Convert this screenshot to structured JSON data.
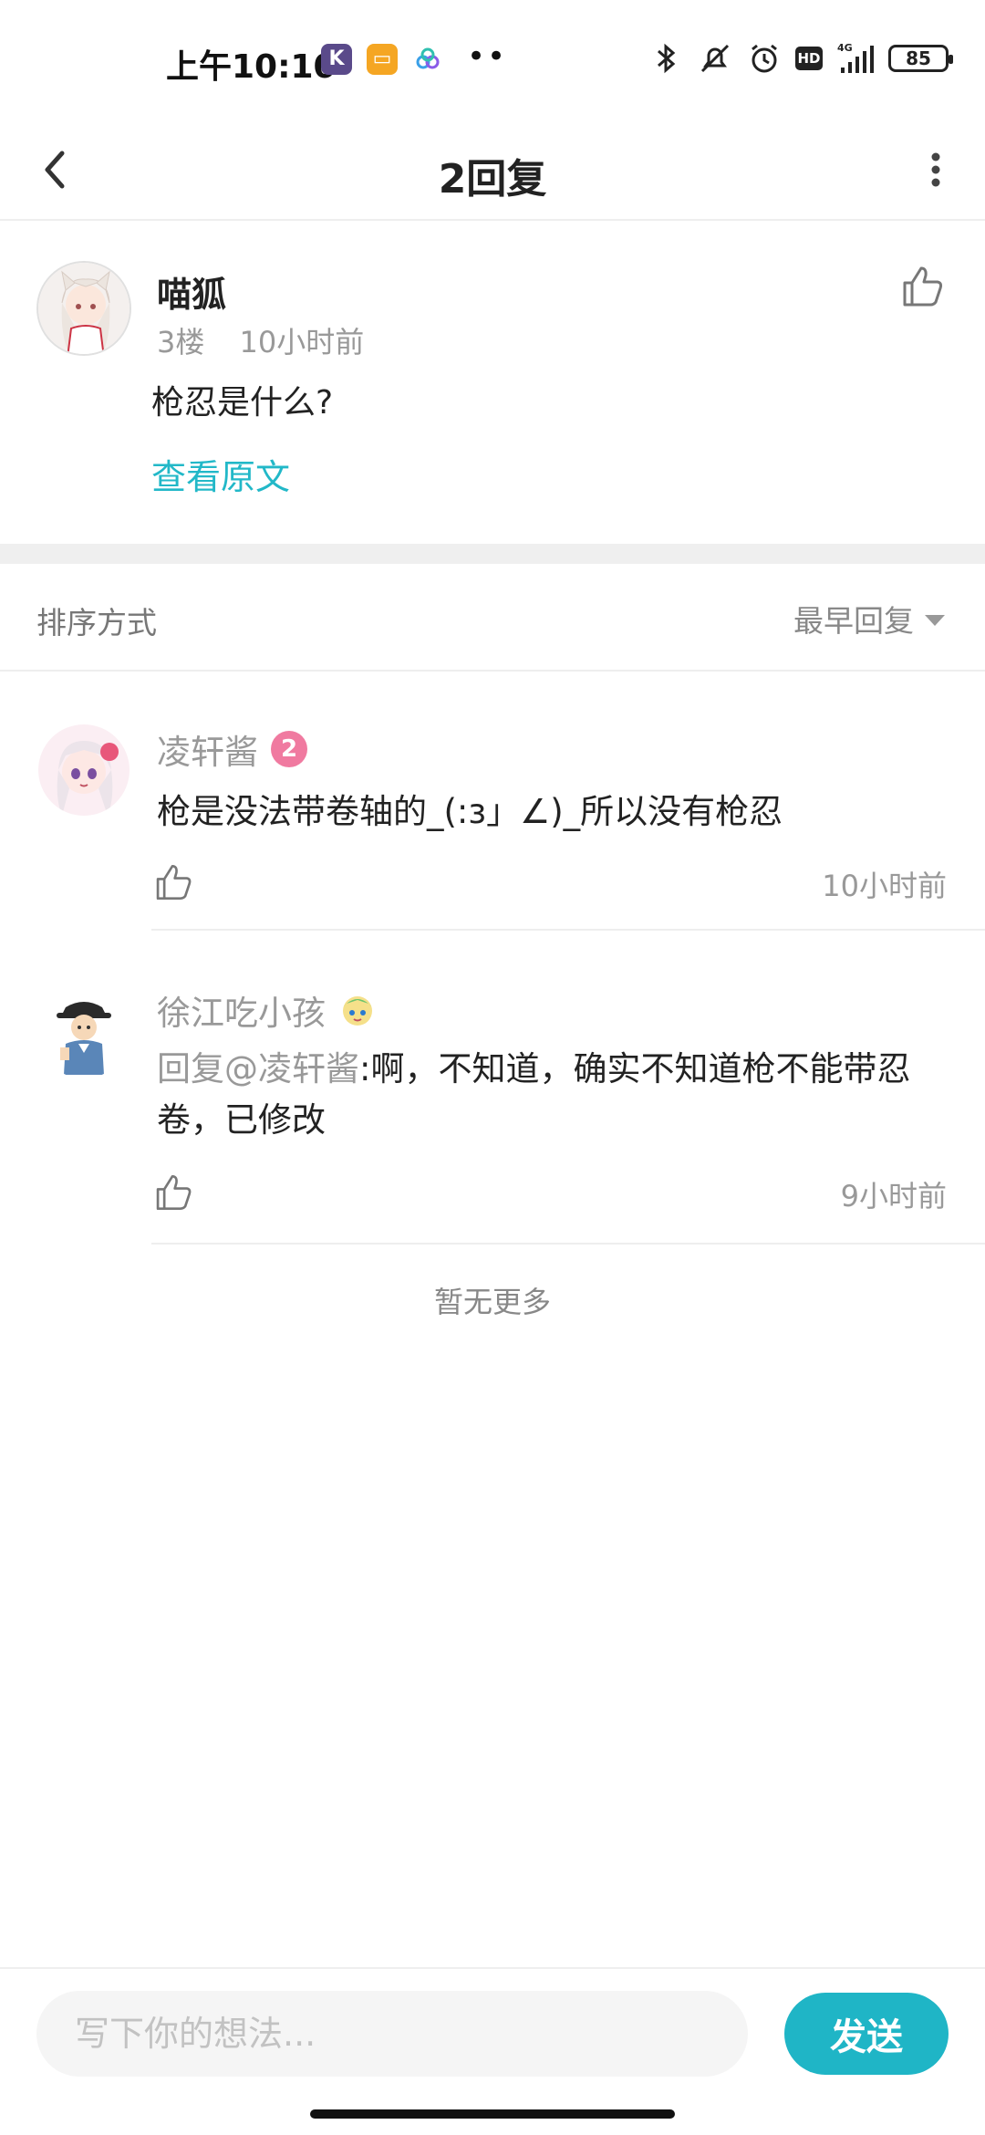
{
  "status_bar": {
    "time": "上午10:10",
    "battery": "85",
    "network": "4G",
    "hd": "HD"
  },
  "header": {
    "title": "2回复"
  },
  "original_post": {
    "author": "喵狐",
    "floor": "3楼",
    "time": "10小时前",
    "content": "枪忍是什么?",
    "view_original": "查看原文"
  },
  "sort": {
    "label": "排序方式",
    "selected": "最早回复"
  },
  "replies": [
    {
      "author": "凌轩酱",
      "level": "2",
      "content": "枪是没法带卷轴的_(:з」∠)_所以没有枪忍",
      "time": "10小时前"
    },
    {
      "author": "徐江吃小孩",
      "mention": "回复@凌轩酱",
      "content": ":啊，不知道，确实不知道枪不能带忍卷，已修改",
      "time": "9小时前"
    }
  ],
  "no_more": "暂无更多",
  "composer": {
    "placeholder": "写下你的想法...",
    "send_label": "发送"
  },
  "colors": {
    "accent": "#1fb5c6",
    "link": "#22b8c8",
    "muted": "#999999"
  }
}
